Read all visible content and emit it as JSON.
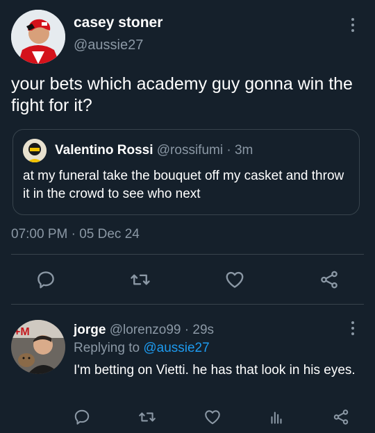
{
  "main_tweet": {
    "author_name": "casey stoner",
    "author_handle": "@aussie27",
    "text": "your bets which academy guy gonna win the fight for it?",
    "timestamp": "07:00 PM · 05 Dec 24",
    "quoted": {
      "author_name": "Valentino Rossi",
      "author_handle": "@rossifumi",
      "separator": "·",
      "time": "3m",
      "text": "at my funeral take the bouquet off my casket and throw it in the crowd to see who next"
    },
    "actions": [
      "reply-icon",
      "retweet-icon",
      "like-icon",
      "share-icon"
    ]
  },
  "reply": {
    "author_name": "jorge",
    "author_handle": "@lorenzo99",
    "separator": "·",
    "time": "29s",
    "replying_prefix": "Replying to",
    "replying_to": "@aussie27",
    "text": "I'm betting on Vietti. he has that look in his eyes.",
    "avatar_badge": "+M",
    "actions": [
      "reply-icon",
      "retweet-icon",
      "like-icon",
      "analytics-icon",
      "share-icon"
    ]
  },
  "colors": {
    "background": "#15202b",
    "text": "#ffffff",
    "muted": "#8b98a5",
    "link": "#1d9bf0",
    "border": "#38444d"
  }
}
